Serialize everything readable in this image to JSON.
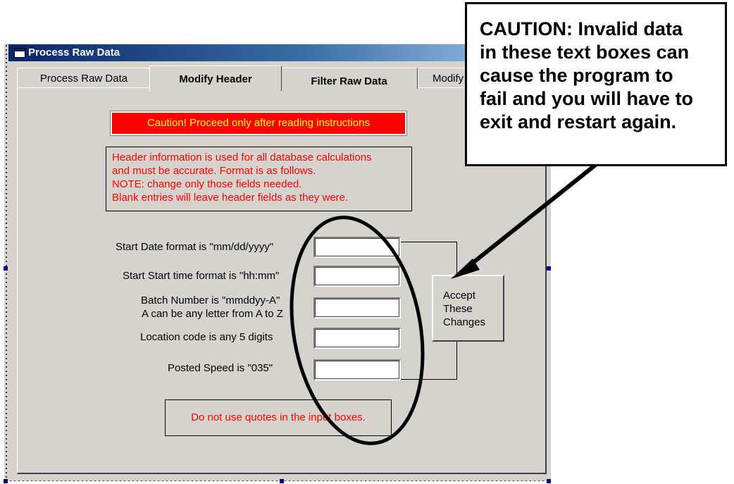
{
  "window": {
    "title": "Process Raw Data"
  },
  "tabs": [
    {
      "label": "Process Raw Data",
      "active": false
    },
    {
      "label": "Modify Header",
      "active": true
    },
    {
      "label": "Filter Raw Data",
      "active": false
    },
    {
      "label": "Modify",
      "active": false
    }
  ],
  "caution_bar": "Caution! Proceed only after reading instructions",
  "header_info": {
    "lines": [
      "Header information is used for all database calculations",
      "and must be accurate. Format is as follows.",
      "NOTE: change only those fields needed.",
      "Blank entries will leave header fields as they were."
    ]
  },
  "fields": [
    {
      "label": "Start Date format is \"mm/dd/yyyy\"",
      "value": ""
    },
    {
      "label": "Start Start time format is \"hh:mm\"",
      "value": ""
    },
    {
      "label_line1": "Batch Number is \"mmddyy-A\"",
      "label_line2": "A can be any letter from A to Z",
      "value": ""
    },
    {
      "label": "Location code is any 5 digits",
      "value": ""
    },
    {
      "label": "Posted Speed is \"035\"",
      "value": ""
    }
  ],
  "accept_button": {
    "lines": [
      "Accept",
      "These",
      "Changes"
    ]
  },
  "quotes_note": "Do not use quotes in the input boxes.",
  "callout": {
    "lines": [
      "CAUTION: Invalid data",
      "in these text boxes can",
      "cause the program to",
      "fail and you will have to",
      "exit and restart again."
    ]
  },
  "colors": {
    "caution_bg": "#ff0000",
    "caution_text": "#ffff00",
    "warning_text": "#ff0000",
    "title_bar": "#0a246a",
    "form_bg": "#d6d3ce"
  }
}
